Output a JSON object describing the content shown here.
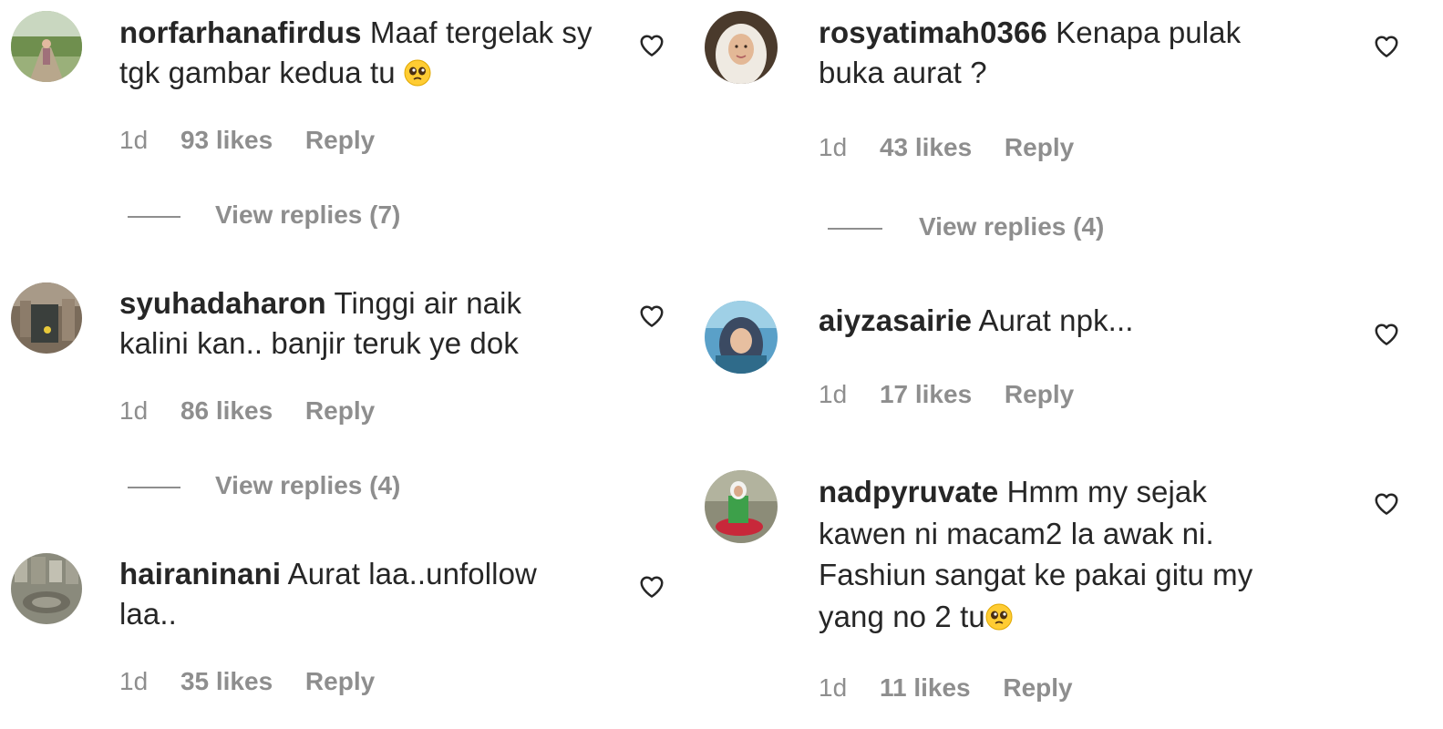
{
  "left_column": {
    "comments": [
      {
        "username": "norfarhanafirdus",
        "text_lines": [
          "Maaf tergelak sy",
          "tgk gambar kedua tu"
        ],
        "emoji": "pleading-face",
        "time": "1d",
        "likes": "93 likes",
        "reply_label": "Reply",
        "view_replies": "View replies (7)"
      },
      {
        "username": "syuhadaharon",
        "text_lines": [
          "Tinggi air naik",
          "kalini kan.. banjir teruk ye dok"
        ],
        "time": "1d",
        "likes": "86 likes",
        "reply_label": "Reply",
        "view_replies": "View replies (4)"
      },
      {
        "username": "hairaninani",
        "text_lines": [
          "Aurat laa..unfollow",
          "laa.."
        ],
        "time": "1d",
        "likes": "35 likes",
        "reply_label": "Reply"
      }
    ]
  },
  "right_column": {
    "comments": [
      {
        "username": "rosyatimah0366",
        "text_lines": [
          "Kenapa pulak",
          "buka aurat ?"
        ],
        "time": "1d",
        "likes": "43 likes",
        "reply_label": "Reply",
        "view_replies": "View replies (4)"
      },
      {
        "username": "aiyzasairie",
        "text_lines": [
          "Aurat npk..."
        ],
        "time": "1d",
        "likes": "17 likes",
        "reply_label": "Reply"
      },
      {
        "username": "nadpyruvate",
        "text_lines": [
          "Hmm my sejak",
          "kawen ni macam2 la awak ni.",
          "Fashiun sangat ke pakai gitu my",
          "yang no 2 tu"
        ],
        "emoji": "pleading-face",
        "time": "1d",
        "likes": "11 likes",
        "reply_label": "Reply"
      }
    ]
  },
  "colors": {
    "primary_text": "#262626",
    "secondary_text": "#8e8e8e",
    "background": "#ffffff"
  }
}
